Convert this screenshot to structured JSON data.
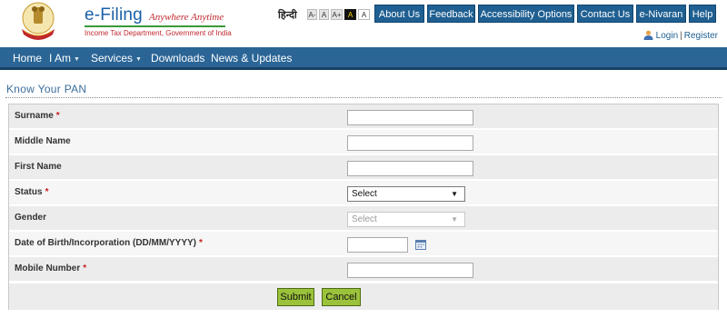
{
  "header": {
    "brand_title": "e-Filing",
    "brand_tagline": "Anywhere Anytime",
    "brand_subtitle": "Income Tax Department, Government of India",
    "language_link": "हिन्दी",
    "font_sizes": [
      "A-",
      "A",
      "A+",
      "A",
      "A"
    ],
    "top_buttons": [
      "About Us",
      "Feedback",
      "Accessibility Options",
      "Contact Us",
      "e-Nivaran",
      "Help"
    ],
    "login": "Login",
    "separator": "|",
    "register": "Register"
  },
  "nav": {
    "items": [
      {
        "label": "Home",
        "dropdown": false
      },
      {
        "label": "I Am",
        "dropdown": true
      },
      {
        "label": "Services",
        "dropdown": true
      },
      {
        "label": "Downloads",
        "dropdown": false
      },
      {
        "label": "News & Updates",
        "dropdown": false
      }
    ],
    "caret": "▼"
  },
  "page": {
    "title": "Know Your PAN"
  },
  "form": {
    "required_mark": "*",
    "fields": {
      "surname": {
        "label": "Surname",
        "value": ""
      },
      "middle_name": {
        "label": "Middle Name",
        "value": ""
      },
      "first_name": {
        "label": "First Name",
        "value": ""
      },
      "status": {
        "label": "Status",
        "value": "Select"
      },
      "gender": {
        "label": "Gender",
        "value": "Select"
      },
      "dob": {
        "label": "Date of Birth/Incorporation (DD/MM/YYYY)",
        "value": ""
      },
      "mobile": {
        "label": "Mobile Number",
        "value": ""
      }
    },
    "submit_label": "Submit",
    "cancel_label": "Cancel"
  },
  "colors": {
    "nav_bg": "#2a6596",
    "top_button_bg": "#1f5f91",
    "action_button_bg": "#9bc23b",
    "required": "#c42020"
  },
  "icons": [
    "emblem-logo",
    "user-icon",
    "calendar-icon",
    "chevron-down-icon"
  ]
}
